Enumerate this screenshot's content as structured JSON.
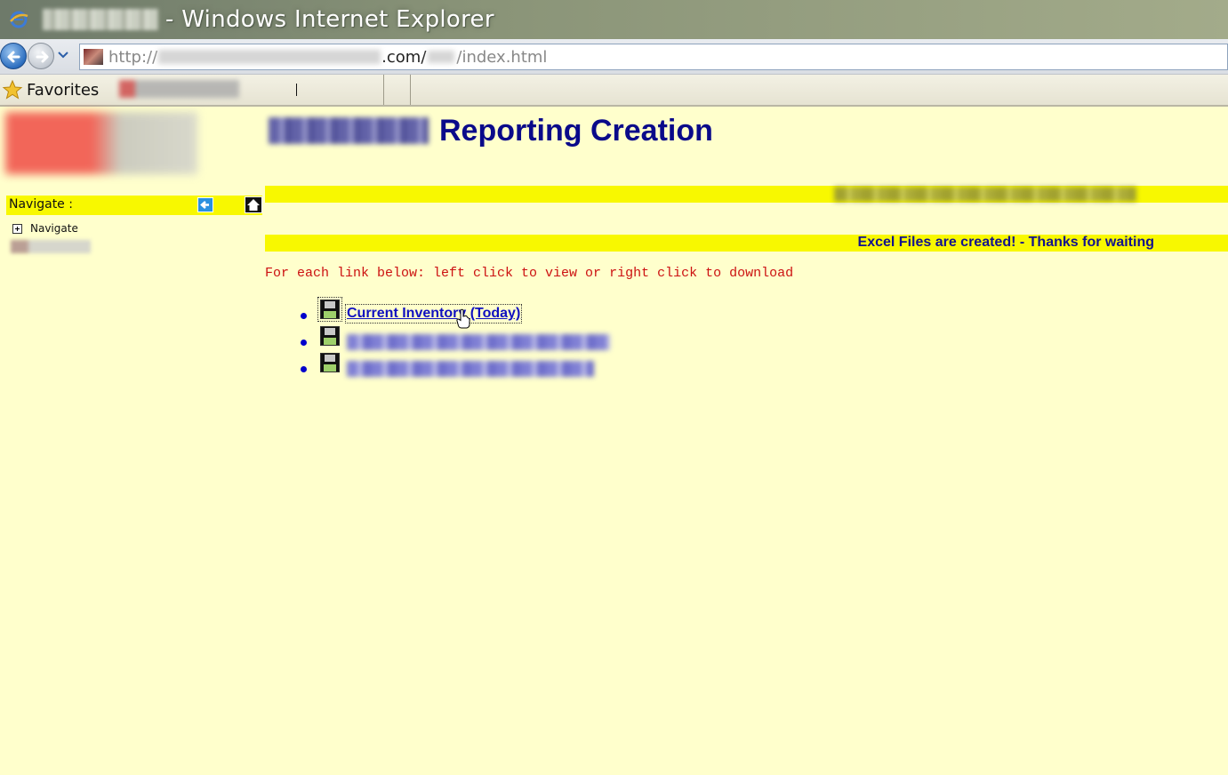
{
  "window": {
    "title": "- Windows Internet Explorer"
  },
  "address": {
    "scheme": "http://",
    "domain_suffix": ".com/",
    "path": "/index.html"
  },
  "favorites": {
    "label": "Favorites"
  },
  "page": {
    "title": "Reporting Creation",
    "status_message": "Excel Files are created! - Thanks for waiting",
    "instruction": "For each link below: left click to view or right click to download",
    "files": [
      {
        "label": "Current Inventory (Today)",
        "icon": "floppy-disk-icon"
      },
      {
        "label": "",
        "icon": "floppy-disk-icon"
      },
      {
        "label": "",
        "icon": "floppy-disk-icon"
      }
    ]
  },
  "sidebar": {
    "header": "Navigate :",
    "tree": [
      {
        "label": "Navigate",
        "icon": "expand-plus-icon"
      }
    ]
  },
  "colors": {
    "page_background": "#ffffcc",
    "band_yellow": "#f8f800",
    "title_blue": "#0a0a8a",
    "instruction_red": "#cc1111",
    "link_blue": "#1010c0"
  }
}
